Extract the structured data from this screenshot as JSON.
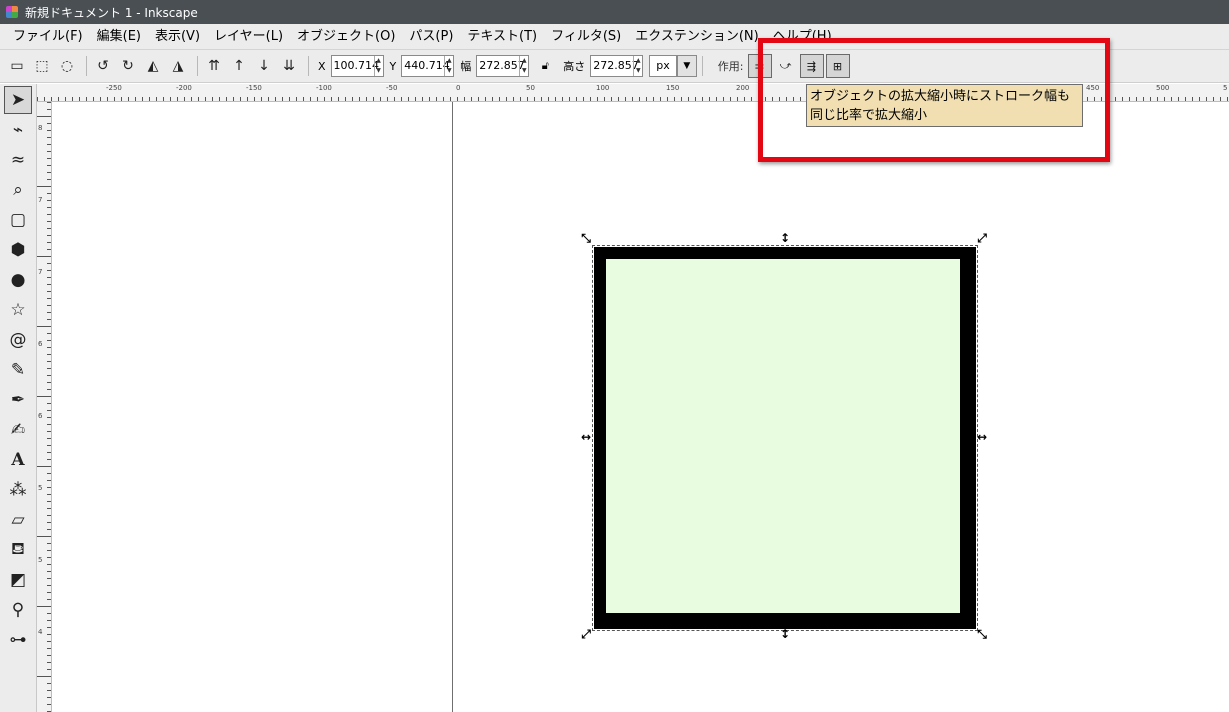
{
  "window": {
    "title": "新規ドキュメント 1 - Inkscape"
  },
  "menu": [
    "ファイル(F)",
    "編集(E)",
    "表示(V)",
    "レイヤー(L)",
    "オブジェクト(O)",
    "パス(P)",
    "テキスト(T)",
    "フィルタ(S)",
    "エクステンション(N)",
    "ヘルプ(H)"
  ],
  "toolcontrols": {
    "x_label": "X",
    "x_value": "100.714",
    "y_label": "Y",
    "y_value": "440.714",
    "w_label": "幅",
    "w_value": "272.857",
    "h_label": "高さ",
    "h_value": "272.857",
    "unit": "px",
    "affect_label": "作用:"
  },
  "tooltip": {
    "text": "オブジェクトの拡大縮小時にストローク幅も同じ比率で拡大縮小"
  },
  "ruler": {
    "h_labels": [
      "-250",
      "-200",
      "-150",
      "-100",
      "-50",
      "0",
      "50",
      "100",
      "150",
      "200",
      "450",
      "500",
      "5"
    ],
    "v_labels": [
      "8",
      "7",
      "7",
      "6",
      "6",
      "5",
      "5",
      "4"
    ]
  },
  "colors": {
    "shape_fill": "#e8fce0",
    "shape_stroke": "#000000",
    "highlight": "#e30613",
    "tooltip_bg": "#f1dfb2"
  },
  "icons": {
    "select_tool": "selector-arrow-icon",
    "node_tool": "node-editor-icon",
    "tweak_tool": "tweak-icon",
    "zoom_tool": "zoom-icon",
    "rect_tool": "rectangle-icon",
    "box3d_tool": "3d-box-icon",
    "ellipse_tool": "ellipse-icon",
    "star_tool": "star-icon",
    "spiral_tool": "spiral-icon",
    "pencil_tool": "pencil-icon",
    "pen_tool": "pen-icon",
    "calligraphy_tool": "calligraphy-icon",
    "text_tool": "text-icon",
    "spray_tool": "spray-icon",
    "eraser_tool": "eraser-icon",
    "bucket_tool": "paint-bucket-icon",
    "gradient_tool": "gradient-icon",
    "dropper_tool": "dropper-icon",
    "connector_tool": "connector-icon"
  }
}
